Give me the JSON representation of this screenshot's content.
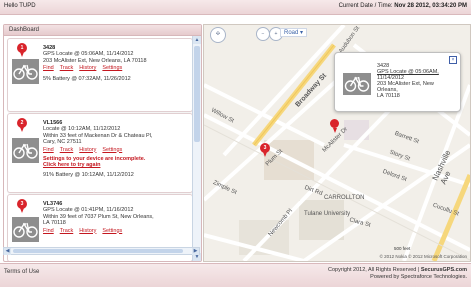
{
  "header": {
    "greeting": "Hello TUPD",
    "datetime_label": "Current Date / Time:",
    "datetime_value": "Nov 28 2012, 03:34:20 PM"
  },
  "dashboard": {
    "title": "DashBoard",
    "devices": [
      {
        "pin": "1",
        "id": "3428",
        "status": "GPS Locate @ 05:06AM, 11/14/2012",
        "address": "203 McAlister Ext, New Orleans, LA 70118",
        "links": [
          "Find",
          "Track",
          "History",
          "Settings"
        ],
        "battery": "5% Battery @ 07:32AM, 11/26/2012"
      },
      {
        "pin": "2",
        "id": "VL1566",
        "status": "Locate @ 10:12AM, 11/12/2012",
        "address_line1": "Within 33 feet of Mackenan Dr & Chateau Pl,",
        "address_line2": "Cary, NC 27511",
        "links": [
          "Find",
          "Track",
          "History",
          "Settings"
        ],
        "warning": "Settings to your device are incomplete.",
        "warning_link": "Click here to try again",
        "battery": "91% Battery @ 10:12AM, 11/12/2012"
      },
      {
        "pin": "3",
        "id": "VL3746",
        "status": "GPS Locate @ 01:41PM, 11/16/2012",
        "address_line1": "Within 39 feet of 7037 Plum St, New Orleans,",
        "address_line2": "LA 70118",
        "links": [
          "Find",
          "Track",
          "History",
          "Settings"
        ]
      }
    ]
  },
  "map": {
    "mode": "Road",
    "road_labels": [
      "Broadway St",
      "Plum St",
      "Willow St",
      "McAlister Dr",
      "Audubon St",
      "Nashville Ave",
      "Story St",
      "Delord St",
      "Barrett St",
      "Cucullu St",
      "Zimple St",
      "Dirt Rd",
      "Newcomb Pl",
      "CARROLLTON",
      "Tulane University",
      "Clara St"
    ],
    "popup": {
      "id": "3428",
      "status": "GPS Locate @ 05:06AM,",
      "status2": "11/14/2012",
      "address": "203 McAlister Ext, New Orleans,",
      "address2": "LA 70118"
    },
    "scale": "500 feet",
    "attribution": "© 2012 Nokia   © 2012 Microsoft Corporation"
  },
  "footer": {
    "terms": "Terms of Use",
    "copyright": "Copyright 2012, All Rights Reserved |",
    "brand": "SecurusGPS.com",
    "powered": "Powered by Spectraforce Technologies."
  },
  "colors": {
    "accent_red": "#d9242b",
    "header_pink": "#ecd5d7"
  }
}
